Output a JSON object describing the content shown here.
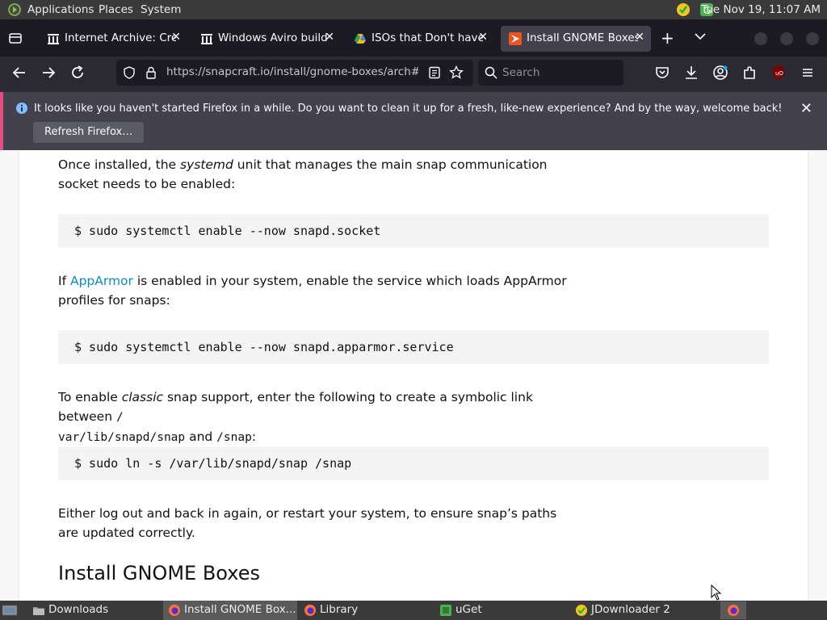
{
  "top_panel": {
    "applications": "Applications",
    "places": "Places",
    "system": "System",
    "clock": "Tue Nov 19, 11:07 AM"
  },
  "tabs": [
    {
      "label": "Internet Archive: Crea",
      "icon": "archive-icon"
    },
    {
      "label": "Windows Aviro build",
      "icon": "archive-icon"
    },
    {
      "label": "ISOs that Don't haven",
      "icon": "drive-icon"
    },
    {
      "label": "Install GNOME Boxes",
      "icon": "snapcraft-icon"
    }
  ],
  "navbar": {
    "url": "https://snapcraft.io/install/gnome-boxes/arch#install",
    "search_placeholder": "Search"
  },
  "notification": {
    "message": "It looks like you haven't started Firefox in a while. Do you want to clean it up for a fresh, like-new experience? And by the way, welcome back!",
    "button": "Refresh Firefox…"
  },
  "content": {
    "p1_pre": "Once installed, the ",
    "p1_em": "systemd",
    "p1_post": " unit that manages the main snap communication socket needs to be enabled:",
    "code1": "$ sudo systemctl enable --now snapd.socket",
    "p2_pre": "If ",
    "p2_link": "AppArmor",
    "p2_post": " is enabled in your system, enable the service which loads AppArmor profiles for snaps:",
    "code2": "$ sudo systemctl enable --now snapd.apparmor.service",
    "p3_pre": "To enable ",
    "p3_em": "classic",
    "p3_mid": " snap support, enter the following to create a symbolic link between ",
    "p3_code1a": "/",
    "p3_code1b": "var/lib/snapd/snap",
    "p3_and": " and ",
    "p3_code2": "/snap",
    "p3_end": ":",
    "code3": "$ sudo ln -s /var/lib/snapd/snap /snap",
    "p4": "Either log out and back in again, or restart your system, to ensure snap’s paths are updated correctly.",
    "heading": "Install GNOME Boxes"
  },
  "taskbar": [
    {
      "label": "Downloads",
      "icon": "folder-icon"
    },
    {
      "label": "Install GNOME Box...",
      "icon": "firefox-icon",
      "active": true
    },
    {
      "label": "Library",
      "icon": "firefox-icon"
    },
    {
      "label": "uGet",
      "icon": "uget-icon"
    },
    {
      "label": "JDownloader 2",
      "icon": "jdownloader-icon"
    }
  ],
  "colors": {
    "accent_link": "#0e8ac8",
    "notif_stripe": "#e44c86",
    "active_tab": "#42414d"
  }
}
